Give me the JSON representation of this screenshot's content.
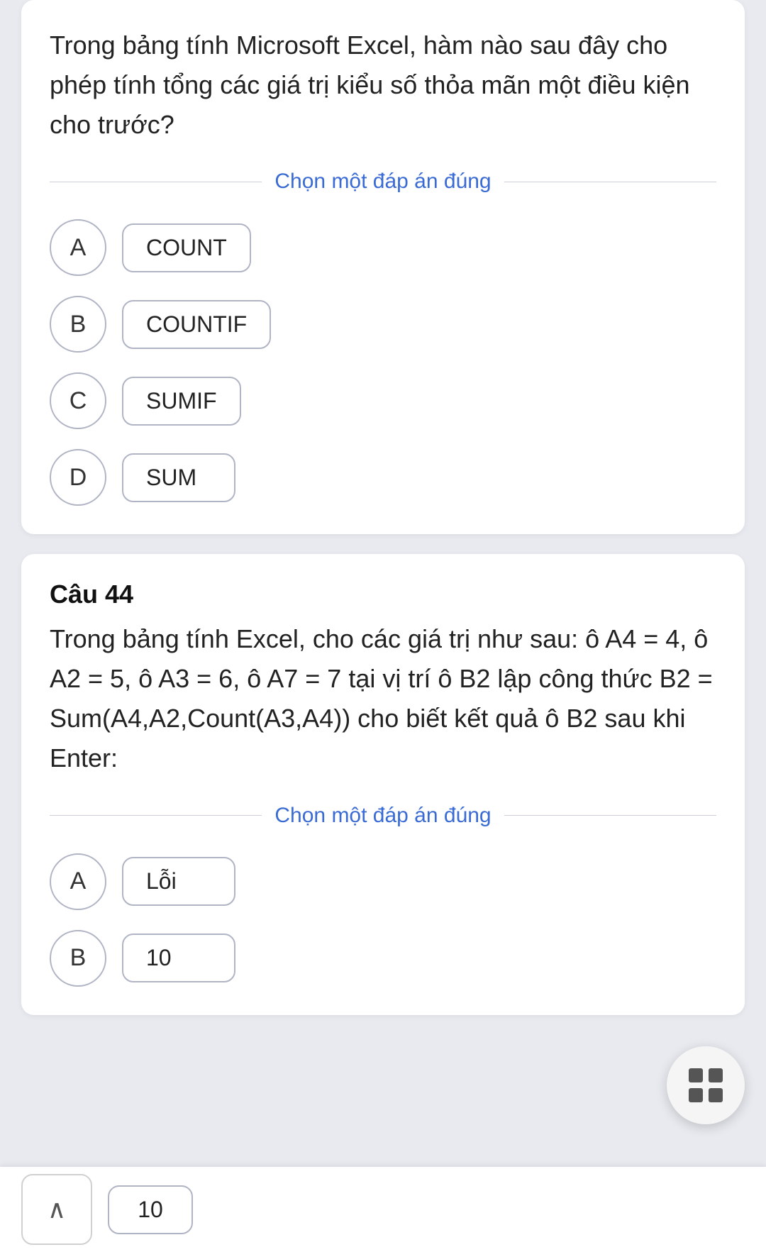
{
  "page": {
    "background_color": "#e8eaf0"
  },
  "question43": {
    "text": "Trong bảng tính Microsoft Excel, hàm nào sau đây cho phép tính tổng các giá trị kiểu số thỏa mãn một điều kiện cho trước?",
    "select_label": "Chọn một đáp án đúng",
    "options": [
      {
        "letter": "A",
        "value": "COUNT"
      },
      {
        "letter": "B",
        "value": "COUNTIF"
      },
      {
        "letter": "C",
        "value": "SUMIF"
      },
      {
        "letter": "D",
        "value": "SUM"
      }
    ]
  },
  "question44": {
    "number": "Câu 44",
    "text": "Trong bảng tính Excel, cho các giá trị như sau: ô A4 = 4, ô A2 = 5, ô A3 = 6, ô A7 = 7 tại vị trí ô B2 lập công thức B2 = Sum(A4,A2,Count(A3,A4)) cho biết kết quả ô B2 sau khi Enter:",
    "select_label": "Chọn một đáp án đúng",
    "options": [
      {
        "letter": "A",
        "value": "Lỗi"
      },
      {
        "letter": "B",
        "value": "10"
      }
    ]
  },
  "fab": {
    "label": "grid-menu"
  },
  "bottom_nav": {
    "arrow_up": "∧",
    "page_number": "10"
  }
}
